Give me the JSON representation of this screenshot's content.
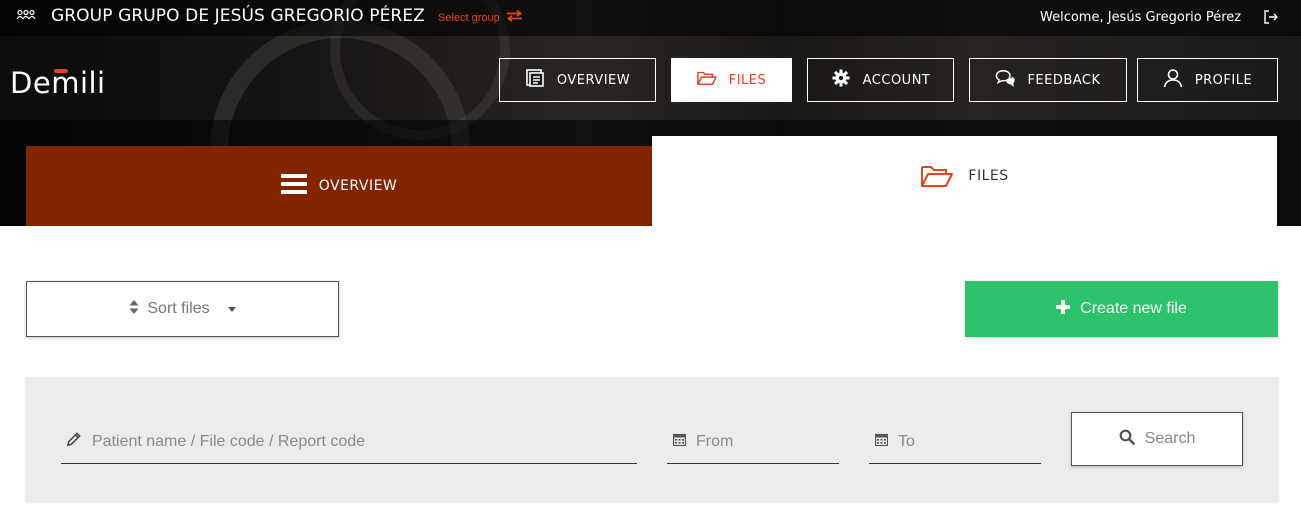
{
  "topbar": {
    "group_title": "GROUP GRUPO DE JESÚS GREGORIO PÉREZ",
    "select_group": "Select group",
    "welcome": "Welcome, Jesús Gregorio Pérez"
  },
  "logo": {
    "text_before": "De",
    "text_m": "m",
    "text_after": "ili"
  },
  "nav": {
    "overview": "OVERVIEW",
    "files": "FILES",
    "account": "ACCOUNT",
    "feedback": "FEEDBACK",
    "profile": "PROFILE",
    "active": "files"
  },
  "tabs": {
    "overview": "OVERVIEW",
    "files": "FILES"
  },
  "toolbar": {
    "sort_label": "Sort files",
    "create_label": "Create new file"
  },
  "filters": {
    "query_placeholder": "Patient name / File code / Report code",
    "from_placeholder": "From",
    "to_placeholder": "To",
    "search_label": "Search"
  },
  "colors": {
    "accent": "#e8411b",
    "overview_tab": "#822500",
    "create_button": "#2dc36a",
    "filter_panel": "#ececec"
  },
  "icons": {
    "group": "group-icon",
    "swap": "swap-arrows-icon",
    "logout": "logout-icon",
    "overview": "document-list-icon",
    "files": "folder-open-icon",
    "account": "gear-icon",
    "feedback": "chat-bubbles-icon",
    "profile": "user-icon",
    "tab_overview": "hamburger-icon",
    "sort": "sort-icon",
    "create": "plus-icon",
    "query": "pencil-icon",
    "date": "calendar-icon",
    "search": "search-icon"
  }
}
